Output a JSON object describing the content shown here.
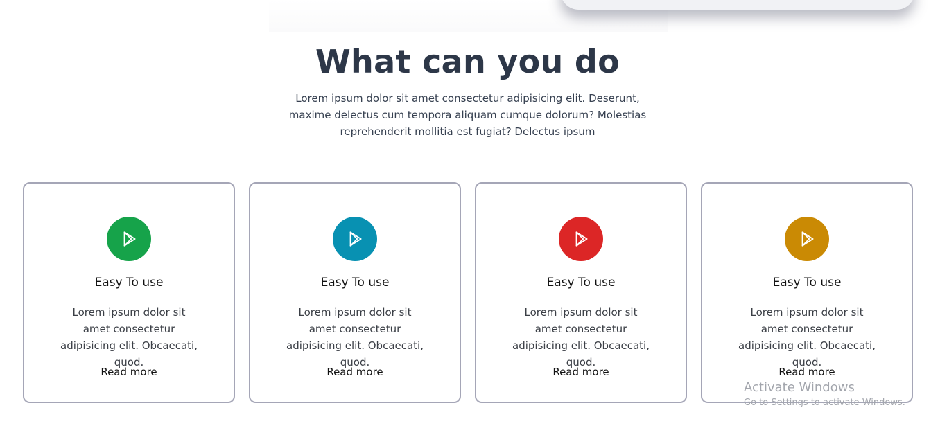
{
  "section": {
    "heading": "What can you do",
    "subtitle": "Lorem ipsum dolor sit amet consectetur adipisicing elit. Deserunt, maxime delectus cum tempora aliquam cumque dolorum? Molestias reprehenderit mollitia est fugiat? Delectus ipsum"
  },
  "cards": [
    {
      "icon": "play-icon",
      "color": "#16a34a",
      "title": "Easy To use",
      "text": "Lorem ipsum dolor sit amet consectetur adipisicing elit. Obcaecati, quod.",
      "link": "Read more"
    },
    {
      "icon": "play-icon",
      "color": "#0891b2",
      "title": "Easy To use",
      "text": "Lorem ipsum dolor sit amet consectetur adipisicing elit. Obcaecati, quod.",
      "link": "Read more"
    },
    {
      "icon": "play-icon",
      "color": "#dc2626",
      "title": "Easy To use",
      "text": "Lorem ipsum dolor sit amet consectetur adipisicing elit. Obcaecati, quod.",
      "link": "Read more"
    },
    {
      "icon": "play-icon",
      "color": "#ca8a04",
      "title": "Easy To use",
      "text": "Lorem ipsum dolor sit amet consectetur adipisicing elit. Obcaecati, quod.",
      "link": "Read more"
    }
  ],
  "watermark": {
    "title": "Activate Windows",
    "subtitle": "Go to Settings to activate Windows."
  }
}
